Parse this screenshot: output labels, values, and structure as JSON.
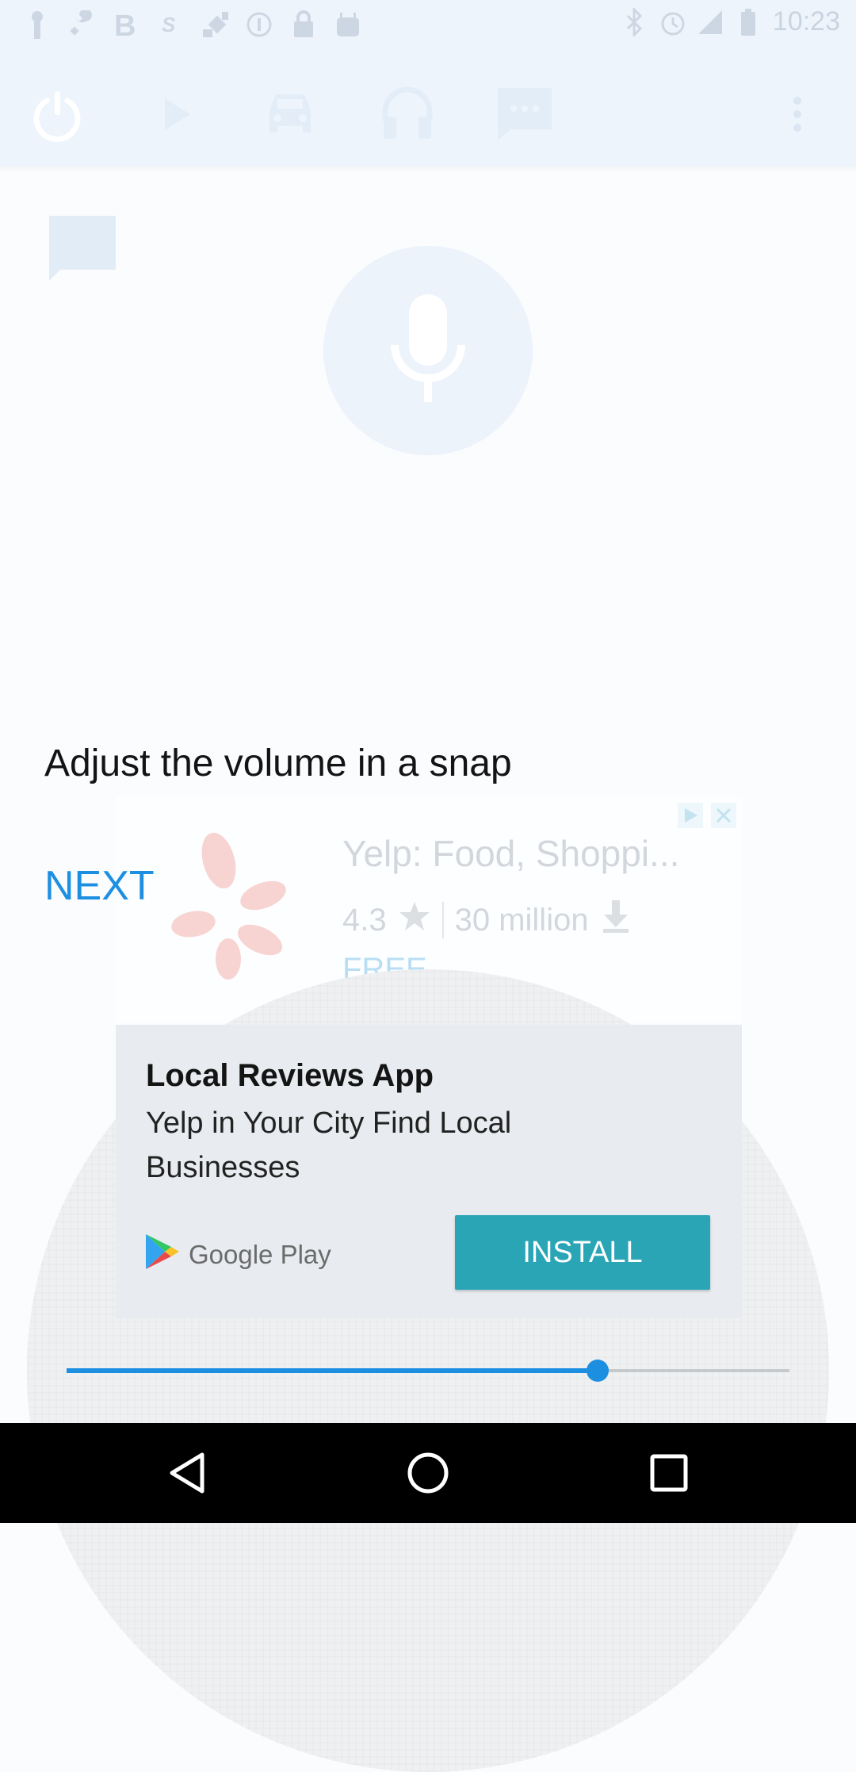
{
  "status_bar": {
    "time": "10:23",
    "left_icons": [
      "notification-icon",
      "wrench-icon",
      "bold-b-icon",
      "brand-s-icon",
      "satellite-icon",
      "info-icon",
      "lock-icon",
      "android-icon"
    ],
    "right_icons": [
      "bluetooth-icon",
      "alarm-icon",
      "signal-icon",
      "battery-icon"
    ]
  },
  "toolbar": {
    "buttons": [
      "power-icon",
      "play-icon",
      "car-icon",
      "headphones-icon",
      "message-icon"
    ],
    "menu_icon": "overflow-menu-icon"
  },
  "tutorial": {
    "headline": "Adjust the volume in a snap",
    "next_label": "NEXT",
    "volume_level": 0.735
  },
  "ad": {
    "app_title": "Yelp: Food, Shoppi...",
    "rating": "4.3",
    "downloads": "30 million",
    "price": "FREE",
    "card_title": "Local Reviews App",
    "card_body": "Yelp in Your City Find Local Businesses",
    "store_name": "Google Play",
    "install_label": "INSTALL",
    "accent_color": "#2aa5b6"
  },
  "colors": {
    "accent_blue": "#1d8fe1",
    "faded_icon": "#cfe0f3"
  }
}
